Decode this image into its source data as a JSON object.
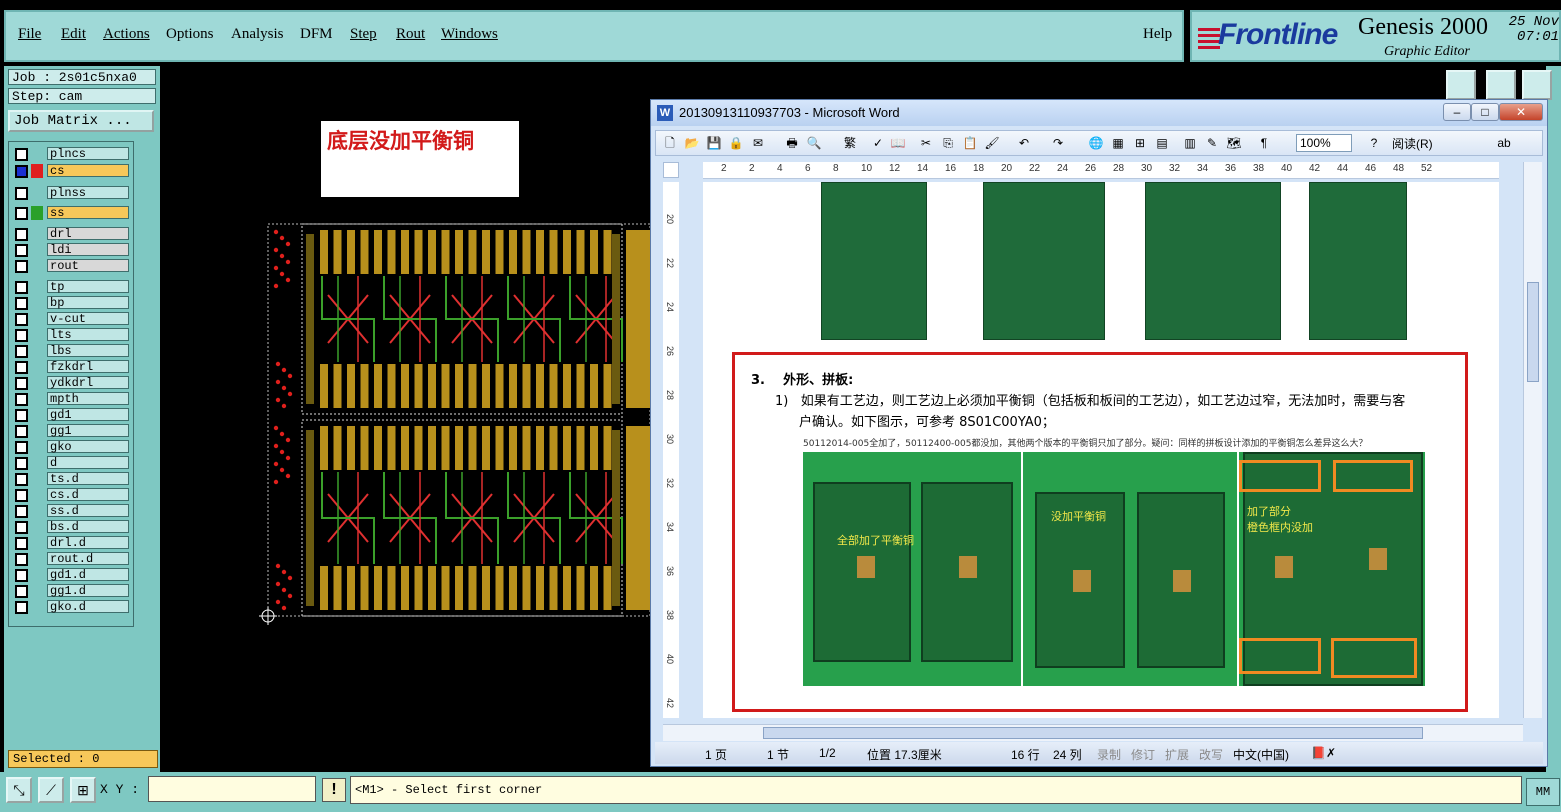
{
  "genesis": {
    "menu": [
      "File",
      "Edit",
      "Actions",
      "Options",
      "Analysis",
      "DFM",
      "Step",
      "Rout",
      "Windows"
    ],
    "help": "Help",
    "brand_logo": "Frontline",
    "product": "Genesis 2000",
    "subtitle": "Graphic Editor",
    "date_line1": "25 Nov",
    "date_line2": "07:01",
    "job": "Job : 2s01c5nxa0",
    "step": "Step: cam",
    "job_matrix": "Job Matrix ...",
    "layers": [
      {
        "name": "plncs",
        "color": ""
      },
      {
        "name": "cs",
        "color": "#e02020",
        "highlight": "#f7c85a",
        "swatch2": "#1a2fd0"
      },
      {
        "name": "plnss",
        "color": ""
      },
      {
        "name": "ss",
        "color": "#2aa02a",
        "highlight": "#f7c85a"
      },
      {
        "name": "drl",
        "color": ""
      },
      {
        "name": "ldi",
        "color": ""
      },
      {
        "name": "rout",
        "color": ""
      },
      {
        "name": "tp",
        "color": ""
      },
      {
        "name": "bp",
        "color": ""
      },
      {
        "name": "v-cut",
        "color": ""
      },
      {
        "name": "lts",
        "color": ""
      },
      {
        "name": "lbs",
        "color": ""
      },
      {
        "name": "fzkdrl",
        "color": ""
      },
      {
        "name": "ydkdrl",
        "color": ""
      },
      {
        "name": "mpth",
        "color": ""
      },
      {
        "name": "gd1",
        "color": ""
      },
      {
        "name": "gg1",
        "color": ""
      },
      {
        "name": "gko",
        "color": ""
      },
      {
        "name": "d",
        "color": ""
      },
      {
        "name": "ts.d",
        "color": ""
      },
      {
        "name": "cs.d",
        "color": ""
      },
      {
        "name": "ss.d",
        "color": ""
      },
      {
        "name": "bs.d",
        "color": ""
      },
      {
        "name": "drl.d",
        "color": ""
      },
      {
        "name": "rout.d",
        "color": ""
      },
      {
        "name": "gd1.d",
        "color": ""
      },
      {
        "name": "gg1.d",
        "color": ""
      },
      {
        "name": "gko.d",
        "color": ""
      }
    ],
    "selected": "Selected : 0",
    "canvas_note": "底层没加平衡铜",
    "xy_label": "X Y :",
    "xy_value": "",
    "message": "<M1> - Select first corner",
    "units": "MM"
  },
  "word": {
    "title": "20130913110937703 - Microsoft Word",
    "zoom": "100%",
    "read_label": "阅读(R)",
    "ruler_marks": [
      "2",
      "2",
      "4",
      "6",
      "8",
      "10",
      "12",
      "14",
      "16",
      "18",
      "20",
      "22",
      "24",
      "26",
      "28",
      "30",
      "32",
      "34",
      "36",
      "38",
      "40",
      "42",
      "44",
      "46",
      "48",
      "52"
    ],
    "vruler_marks": [
      "20",
      "22",
      "24",
      "26",
      "28",
      "30",
      "32",
      "34",
      "36",
      "38",
      "40",
      "42"
    ],
    "section_number": "3.",
    "section_title": "外形、拼板:",
    "item_number": "1)",
    "paragraph_line1": "如果有工艺边，则工艺边上必须加平衡铜（包括板和板间的工艺边），如工艺边过窄，无法加时，需要与客",
    "paragraph_line2": "户确认。如下图示，可参考 8S01C00YA0；",
    "caption": "50112014-005全加了，50112400-005都没加，其他两个版本的平衡铜只加了部分。疑问：同样的拼板设计添加的平衡铜怎么差异这么大？",
    "img_label1": "全部加了平衡铜",
    "img_label2": "没加平衡铜",
    "img_label3": "加了部分\n橙色框内没加",
    "status": {
      "page": "1 页",
      "section": "1 节",
      "pages": "1/2",
      "position": "位置 17.3厘米",
      "line": "16 行",
      "column": "24 列",
      "rec": "录制",
      "trk": "修订",
      "ext": "扩展",
      "ovr": "改写",
      "lang": "中文(中国)"
    }
  }
}
